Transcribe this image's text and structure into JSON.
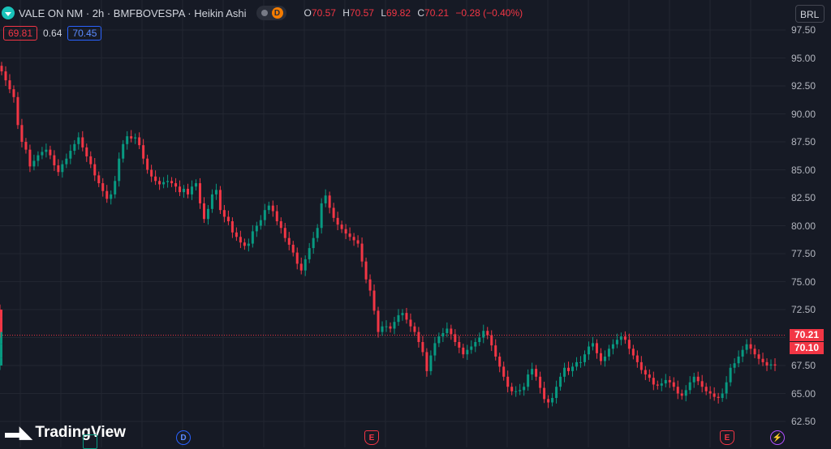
{
  "header": {
    "symbol_icon": "down-chevron-circle-icon",
    "title": "VALE ON NM · 2h · BMFBOVESPA · Heikin Ashi",
    "badge_letter": "D",
    "ohlc": {
      "o_label": "O",
      "o": "70.57",
      "h_label": "H",
      "h": "70.57",
      "l_label": "L",
      "l": "69.82",
      "c_label": "C",
      "c": "70.21",
      "change": "−0.28 (−0.40%)"
    },
    "bid": "69.81",
    "spread": "0.64",
    "ask": "70.45"
  },
  "currency": "BRL",
  "axis": {
    "ticks": [
      "97.50",
      "95.00",
      "92.50",
      "90.00",
      "87.50",
      "85.00",
      "82.50",
      "80.00",
      "77.50",
      "75.00",
      "72.50",
      "70.00",
      "67.50",
      "65.00",
      "62.50"
    ],
    "price_label": "70.21",
    "price_label2": "70.10"
  },
  "logo": "TradingView",
  "events": {
    "d": "D",
    "e1": "E",
    "e2": "E",
    "s": "⚡"
  },
  "colors": {
    "up": "#089981",
    "down": "#f23645",
    "background": "#161a25",
    "grid": "#222631"
  },
  "chart_data": {
    "type": "candlestick",
    "style": "Heikin Ashi",
    "ylim": [
      62.5,
      97.5
    ],
    "grid": true,
    "last_price": 70.21,
    "x": [
      0,
      5,
      10,
      15,
      20,
      25,
      30,
      35,
      40,
      45,
      50,
      55,
      60,
      65,
      70,
      75,
      80,
      85,
      90,
      95,
      100,
      105,
      110,
      115,
      120,
      125,
      130,
      135,
      140,
      145,
      150,
      155,
      160,
      165,
      170,
      175,
      180,
      185,
      190,
      195,
      200,
      205,
      210,
      215,
      220,
      225,
      230,
      235,
      240,
      245,
      250,
      255,
      260,
      265,
      270,
      275,
      280,
      285,
      290,
      295,
      300,
      305,
      310,
      315,
      320,
      325,
      330,
      335,
      340,
      345,
      350,
      355,
      360,
      365,
      370,
      375,
      380,
      385,
      390,
      395,
      400,
      405,
      410,
      415,
      420,
      425,
      430,
      435,
      440,
      445,
      450,
      455,
      460,
      465,
      470,
      475,
      480,
      485,
      490,
      495,
      500,
      505,
      510,
      515,
      520,
      525,
      530,
      535,
      540,
      545,
      550,
      555,
      560,
      565,
      570,
      575,
      580,
      585,
      590,
      595,
      600,
      605,
      610,
      615,
      620,
      625,
      630,
      635,
      640,
      645,
      650,
      655,
      660,
      665,
      670,
      675,
      680,
      685,
      690,
      695,
      700,
      705,
      710,
      715,
      720,
      725,
      730,
      735,
      740,
      745,
      750,
      755,
      760,
      765,
      770,
      775,
      780,
      785,
      790,
      795,
      800,
      805,
      810,
      815,
      820,
      825,
      830,
      835,
      840,
      845,
      850,
      855,
      860,
      865,
      870,
      875,
      880,
      885,
      890,
      895,
      900,
      905,
      910,
      915,
      920,
      925,
      930,
      935,
      940,
      945,
      950,
      955
    ],
    "close": [
      93.8,
      93.0,
      92.2,
      91.5,
      89.0,
      87.5,
      86.8,
      85.3,
      85.8,
      86.3,
      86.6,
      86.8,
      86.3,
      85.4,
      84.8,
      85.5,
      86.0,
      86.7,
      87.3,
      87.9,
      87.0,
      86.2,
      85.5,
      84.5,
      83.8,
      83.1,
      82.4,
      82.8,
      84.0,
      86.0,
      87.3,
      88.0,
      87.8,
      87.9,
      87.2,
      86.0,
      85.0,
      84.4,
      84.0,
      83.7,
      83.9,
      84.0,
      83.8,
      83.5,
      83.0,
      83.3,
      82.8,
      83.5,
      83.8,
      82.0,
      80.6,
      81.5,
      82.8,
      83.2,
      81.4,
      80.8,
      80.4,
      79.4,
      79.0,
      78.5,
      78.2,
      78.4,
      79.5,
      80.0,
      80.5,
      81.4,
      81.8,
      81.3,
      80.4,
      79.8,
      78.9,
      78.3,
      77.6,
      76.6,
      76.0,
      77.0,
      78.0,
      78.9,
      79.8,
      82.0,
      82.7,
      81.6,
      80.7,
      80.1,
      79.7,
      79.3,
      79.0,
      78.7,
      78.4,
      76.8,
      75.2,
      74.2,
      72.4,
      70.5,
      71.0,
      71.0,
      70.8,
      71.4,
      72.0,
      72.2,
      71.6,
      71.0,
      70.5,
      69.6,
      68.7,
      67.0,
      68.4,
      69.5,
      70.1,
      70.4,
      70.8,
      70.3,
      69.6,
      69.1,
      68.5,
      68.9,
      69.2,
      69.6,
      70.0,
      70.6,
      70.2,
      69.3,
      68.3,
      67.4,
      66.5,
      65.6,
      65.2,
      65.2,
      65.3,
      65.6,
      66.7,
      67.2,
      66.5,
      65.5,
      64.5,
      64.2,
      64.6,
      65.6,
      66.5,
      67.3,
      67.0,
      67.4,
      67.8,
      67.8,
      68.5,
      69.2,
      69.5,
      68.6,
      67.9,
      68.3,
      69.0,
      69.4,
      69.8,
      70.1,
      69.8,
      69.0,
      68.4,
      67.8,
      67.1,
      66.7,
      66.4,
      65.8,
      65.7,
      65.9,
      66.2,
      66.0,
      65.6,
      65.0,
      64.8,
      65.3,
      66.0,
      66.5,
      66.1,
      65.6,
      65.2,
      65.0,
      64.7,
      64.6,
      65.0,
      66.0,
      67.3,
      67.7,
      68.3,
      68.9,
      69.4,
      69.0,
      68.5,
      68.1,
      67.8,
      67.5,
      67.6,
      67.5,
      67.6,
      67.6,
      68.2,
      69.4,
      70.8,
      72.1,
      72.5,
      71.8,
      71.2,
      70.5
    ]
  }
}
